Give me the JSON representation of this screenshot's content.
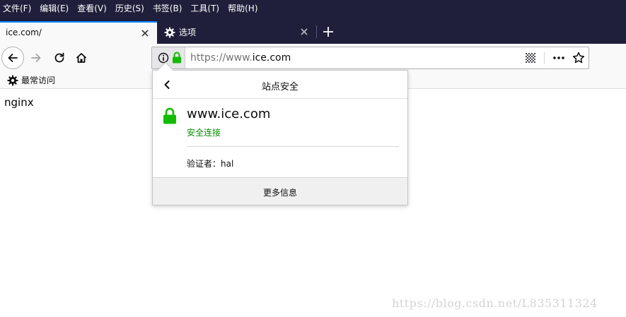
{
  "menubar": {
    "items": [
      {
        "label": "文件(F)"
      },
      {
        "label": "编辑(E)"
      },
      {
        "label": "查看(V)"
      },
      {
        "label": "历史(S)"
      },
      {
        "label": "书签(B)"
      },
      {
        "label": "工具(T)"
      },
      {
        "label": "帮助(H)"
      }
    ]
  },
  "tabs": [
    {
      "title": "ice.com/",
      "active": true
    },
    {
      "title": "选项",
      "active": false,
      "icon": "gear-icon"
    }
  ],
  "urlbar": {
    "scheme": "https://www.",
    "host": "ice.com"
  },
  "bookmarks": {
    "items": [
      {
        "label": "最常访问",
        "icon": "gear-icon"
      }
    ]
  },
  "content": {
    "body_text": "nginx"
  },
  "site_security_panel": {
    "title": "站点安全",
    "host": "www.ice.com",
    "status": "安全连接",
    "verifier": "验证者：hal",
    "more_info_button": "更多信息"
  },
  "watermark": "https://blog.csdn.net/L835311324",
  "colors": {
    "chrome_dark": "#1f1f3b",
    "accent_blue": "#0a84ff",
    "secure_green": "#12bc00",
    "secure_text": "#058b00"
  }
}
